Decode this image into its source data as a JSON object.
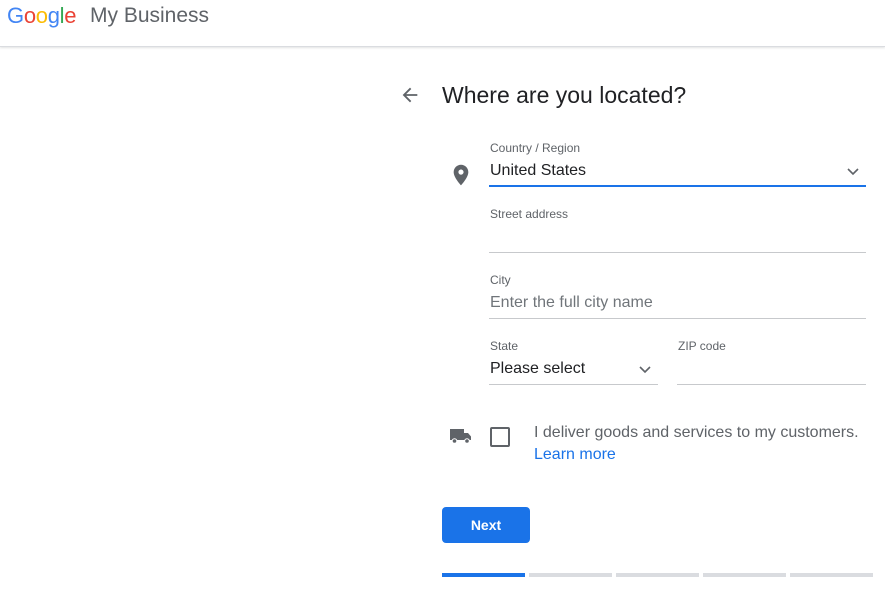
{
  "header": {
    "logo_letters": [
      {
        "char": "G",
        "color": "#4285F4"
      },
      {
        "char": "o",
        "color": "#EA4335"
      },
      {
        "char": "o",
        "color": "#FBBC05"
      },
      {
        "char": "g",
        "color": "#4285F4"
      },
      {
        "char": "l",
        "color": "#34A853"
      },
      {
        "char": "e",
        "color": "#EA4335"
      }
    ],
    "product_name": "My Business"
  },
  "page": {
    "title": "Where are you located?",
    "back_icon": "arrow-back-icon"
  },
  "form": {
    "country": {
      "label": "Country / Region",
      "value": "United States",
      "icon": "location-pin-icon"
    },
    "street": {
      "label": "Street address",
      "value": ""
    },
    "city": {
      "label": "City",
      "placeholder": "Enter the full city name"
    },
    "state": {
      "label": "State",
      "value": "Please select"
    },
    "zip": {
      "label": "ZIP code",
      "value": ""
    },
    "delivery": {
      "icon": "truck-icon",
      "checked": false,
      "text": "I deliver goods and services to my customers.",
      "link": "Learn more"
    }
  },
  "actions": {
    "next_label": "Next"
  },
  "progress": {
    "total_steps": 5,
    "current_step": 1
  },
  "colors": {
    "accent": "#1a73e8",
    "text_primary": "#202124",
    "text_secondary": "#5f6368"
  }
}
